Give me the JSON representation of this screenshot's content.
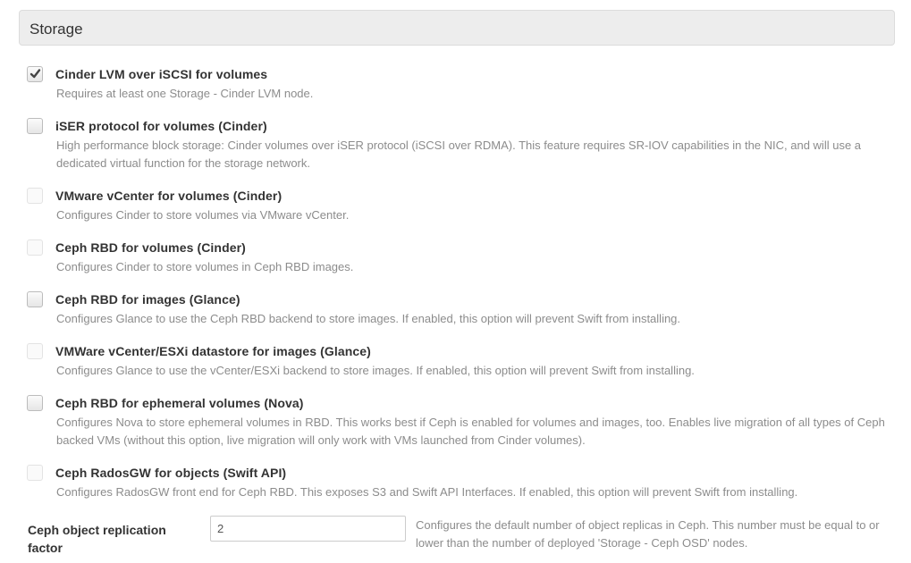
{
  "section": {
    "title": "Storage"
  },
  "options": [
    {
      "label": "Cinder LVM over iSCSI for volumes",
      "description": "Requires at least one Storage - Cinder LVM node.",
      "checked": true,
      "disabled": false
    },
    {
      "label": "iSER protocol for volumes (Cinder)",
      "description": "High performance block storage: Cinder volumes over iSER protocol (iSCSI over RDMA). This feature requires SR-IOV capabilities in the NIC, and will use a dedicated virtual function for the storage network.",
      "checked": false,
      "disabled": false
    },
    {
      "label": "VMware vCenter for volumes (Cinder)",
      "description": "Configures Cinder to store volumes via VMware vCenter.",
      "checked": false,
      "disabled": true
    },
    {
      "label": "Ceph RBD for volumes (Cinder)",
      "description": "Configures Cinder to store volumes in Ceph RBD images.",
      "checked": false,
      "disabled": true
    },
    {
      "label": "Ceph RBD for images (Glance)",
      "description": "Configures Glance to use the Ceph RBD backend to store images. If enabled, this option will prevent Swift from installing.",
      "checked": false,
      "disabled": false
    },
    {
      "label": "VMWare vCenter/ESXi datastore for images (Glance)",
      "description": "Configures Glance to use the vCenter/ESXi backend to store images. If enabled, this option will prevent Swift from installing.",
      "checked": false,
      "disabled": true
    },
    {
      "label": "Ceph RBD for ephemeral volumes (Nova)",
      "description": "Configures Nova to store ephemeral volumes in RBD. This works best if Ceph is enabled for volumes and images, too. Enables live migration of all types of Ceph backed VMs (without this option, live migration will only work with VMs launched from Cinder volumes).",
      "checked": false,
      "disabled": false
    },
    {
      "label": "Ceph RadosGW for objects (Swift API)",
      "description": "Configures RadosGW front end for Ceph RBD. This exposes S3 and Swift API Interfaces. If enabled, this option will prevent Swift from installing.",
      "checked": false,
      "disabled": true
    }
  ],
  "replication": {
    "label": "Ceph object replication factor",
    "value": "2",
    "description": "Configures the default number of object replicas in Ceph. This number must be equal to or lower than the number of deployed 'Storage - Ceph OSD' nodes."
  }
}
